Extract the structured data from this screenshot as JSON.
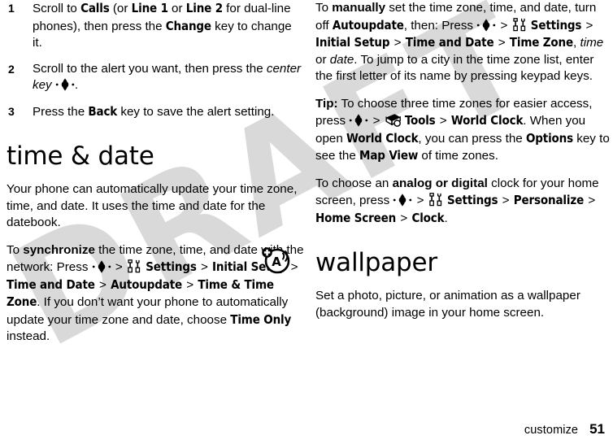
{
  "page": {
    "footer_section": "customize",
    "footer_page_number": "51",
    "watermark_text": "DRAFT",
    "watermark_color": "#d9d9d9"
  },
  "left_column": {
    "steps": [
      {
        "number": "1",
        "runs": [
          {
            "t": "Scroll to ",
            "s": "n"
          },
          {
            "t": "Calls",
            "s": "b"
          },
          {
            "t": " (or ",
            "s": "n"
          },
          {
            "t": "Line 1",
            "s": "b"
          },
          {
            "t": " or ",
            "s": "n"
          },
          {
            "t": "Line 2",
            "s": "b"
          },
          {
            "t": " for dual-line phones), then press the ",
            "s": "n"
          },
          {
            "t": "Change",
            "s": "b"
          },
          {
            "t": " key to change it.",
            "s": "n"
          }
        ]
      },
      {
        "number": "2",
        "runs": [
          {
            "t": "Scroll to the alert you want, then press the ",
            "s": "n"
          },
          {
            "t": "center key",
            "s": "i"
          },
          {
            "t": " ",
            "s": "n"
          },
          {
            "t": "",
            "s": "icon-centerkey"
          },
          {
            "t": ".",
            "s": "n"
          }
        ]
      },
      {
        "number": "3",
        "runs": [
          {
            "t": "Press the ",
            "s": "n"
          },
          {
            "t": "Back",
            "s": "b"
          },
          {
            "t": " key to save the alert setting.",
            "s": "n"
          }
        ]
      }
    ],
    "heading": "time & date",
    "paragraphs": [
      {
        "runs": [
          {
            "t": "Your phone can automatically update your time zone, time, and date. It uses the time and date for the datebook.",
            "s": "n"
          }
        ]
      },
      {
        "runs": [
          {
            "t": "To ",
            "s": "n"
          },
          {
            "t": "synchronize",
            "s": "strong"
          },
          {
            "t": " the time zone, time, and date with the network: Press ",
            "s": "n"
          },
          {
            "t": "",
            "s": "icon-centerkey"
          },
          {
            "t": " > ",
            "s": "gt"
          },
          {
            "t": "",
            "s": "icon-settings"
          },
          {
            "t": " ",
            "s": "n"
          },
          {
            "t": "Settings",
            "s": "b"
          },
          {
            "t": " > ",
            "s": "gt"
          },
          {
            "t": "Initial Setup",
            "s": "b"
          },
          {
            "t": " > ",
            "s": "gt"
          },
          {
            "t": "Time and Date",
            "s": "b"
          },
          {
            "t": " > ",
            "s": "gt"
          },
          {
            "t": "Autoupdate",
            "s": "b"
          },
          {
            "t": " > ",
            "s": "gt"
          },
          {
            "t": "Time & Time Zone",
            "s": "b"
          },
          {
            "t": ". If you don’t want your phone to automatically update your time zone and date, choose ",
            "s": "n"
          },
          {
            "t": "Time Only",
            "s": "b"
          },
          {
            "t": " instead.",
            "s": "n"
          }
        ]
      }
    ],
    "margin_icon_name": "network-autoupdate-icon"
  },
  "right_column": {
    "paragraphs": [
      {
        "runs": [
          {
            "t": "To ",
            "s": "n"
          },
          {
            "t": "manually",
            "s": "strong"
          },
          {
            "t": " set the time zone, time, and date, turn off ",
            "s": "n"
          },
          {
            "t": "Autoupdate",
            "s": "b"
          },
          {
            "t": ", then: Press ",
            "s": "n"
          },
          {
            "t": "",
            "s": "icon-centerkey"
          },
          {
            "t": " > ",
            "s": "gt"
          },
          {
            "t": "",
            "s": "icon-settings"
          },
          {
            "t": " ",
            "s": "n"
          },
          {
            "t": "Settings",
            "s": "b"
          },
          {
            "t": " > ",
            "s": "gt"
          },
          {
            "t": "Initial Setup",
            "s": "b"
          },
          {
            "t": " > ",
            "s": "gt"
          },
          {
            "t": "Time and Date",
            "s": "b"
          },
          {
            "t": " > ",
            "s": "gt"
          },
          {
            "t": "Time Zone",
            "s": "b"
          },
          {
            "t": ", ",
            "s": "n"
          },
          {
            "t": "time",
            "s": "i"
          },
          {
            "t": " or ",
            "s": "n"
          },
          {
            "t": "date",
            "s": "i"
          },
          {
            "t": ". To jump to a city in the time zone list, enter the first letter of its name by pressing keypad keys.",
            "s": "n"
          }
        ]
      },
      {
        "runs": [
          {
            "t": "Tip:",
            "s": "strong"
          },
          {
            "t": " To choose three time zones for easier access, press ",
            "s": "n"
          },
          {
            "t": "",
            "s": "icon-centerkey"
          },
          {
            "t": " > ",
            "s": "gt"
          },
          {
            "t": "",
            "s": "icon-tools"
          },
          {
            "t": " ",
            "s": "n"
          },
          {
            "t": "Tools",
            "s": "b"
          },
          {
            "t": " > ",
            "s": "gt"
          },
          {
            "t": "World Clock",
            "s": "b"
          },
          {
            "t": ". When you open ",
            "s": "n"
          },
          {
            "t": "World Clock",
            "s": "b"
          },
          {
            "t": ", you can press the ",
            "s": "n"
          },
          {
            "t": "Options",
            "s": "b"
          },
          {
            "t": " key to see the ",
            "s": "n"
          },
          {
            "t": "Map View",
            "s": "b"
          },
          {
            "t": " of time zones.",
            "s": "n"
          }
        ]
      },
      {
        "runs": [
          {
            "t": "To choose an ",
            "s": "n"
          },
          {
            "t": "analog or digital",
            "s": "strong"
          },
          {
            "t": " clock for your home screen, press ",
            "s": "n"
          },
          {
            "t": "",
            "s": "icon-centerkey"
          },
          {
            "t": " > ",
            "s": "gt"
          },
          {
            "t": "",
            "s": "icon-settings"
          },
          {
            "t": " ",
            "s": "n"
          },
          {
            "t": "Settings",
            "s": "b"
          },
          {
            "t": " > ",
            "s": "gt"
          },
          {
            "t": "Personalize",
            "s": "b"
          },
          {
            "t": " > ",
            "s": "gt"
          },
          {
            "t": "Home Screen",
            "s": "b"
          },
          {
            "t": " > ",
            "s": "gt"
          },
          {
            "t": "Clock",
            "s": "b"
          },
          {
            "t": ".",
            "s": "n"
          }
        ]
      }
    ],
    "heading": "wallpaper",
    "paragraphs_after_heading": [
      {
        "runs": [
          {
            "t": "Set a photo, picture, or animation as a wallpaper (background) image in your home screen.",
            "s": "n"
          }
        ]
      }
    ]
  }
}
